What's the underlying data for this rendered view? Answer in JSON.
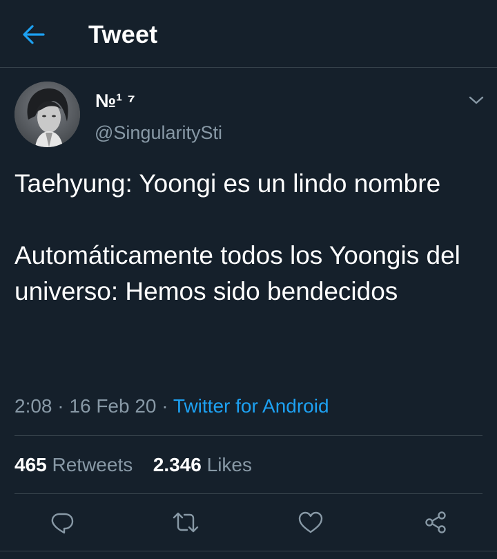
{
  "header": {
    "title": "Tweet",
    "back_icon": "arrow-left-icon"
  },
  "author": {
    "display_name": "№¹ ⁷",
    "username": "@SingularitySti"
  },
  "tweet": {
    "paragraphs": [
      "Taehyung: Yoongi es un lindo nombre",
      "Automáticamente todos los Yoongis del universo: Hemos sido bendecidos"
    ],
    "time": "2:08",
    "separator": " · ",
    "date": "16 Feb 20",
    "source": "Twitter for Android"
  },
  "stats": {
    "retweets_count": "465",
    "retweets_label": "Retweets",
    "likes_count": "2.346",
    "likes_label": "Likes"
  },
  "actions": [
    "reply-icon",
    "retweet-icon",
    "like-icon",
    "share-icon"
  ],
  "colors": {
    "background": "#15202b",
    "accent": "#1da1f2",
    "secondary_text": "#8899a6",
    "divider": "#38444d"
  }
}
